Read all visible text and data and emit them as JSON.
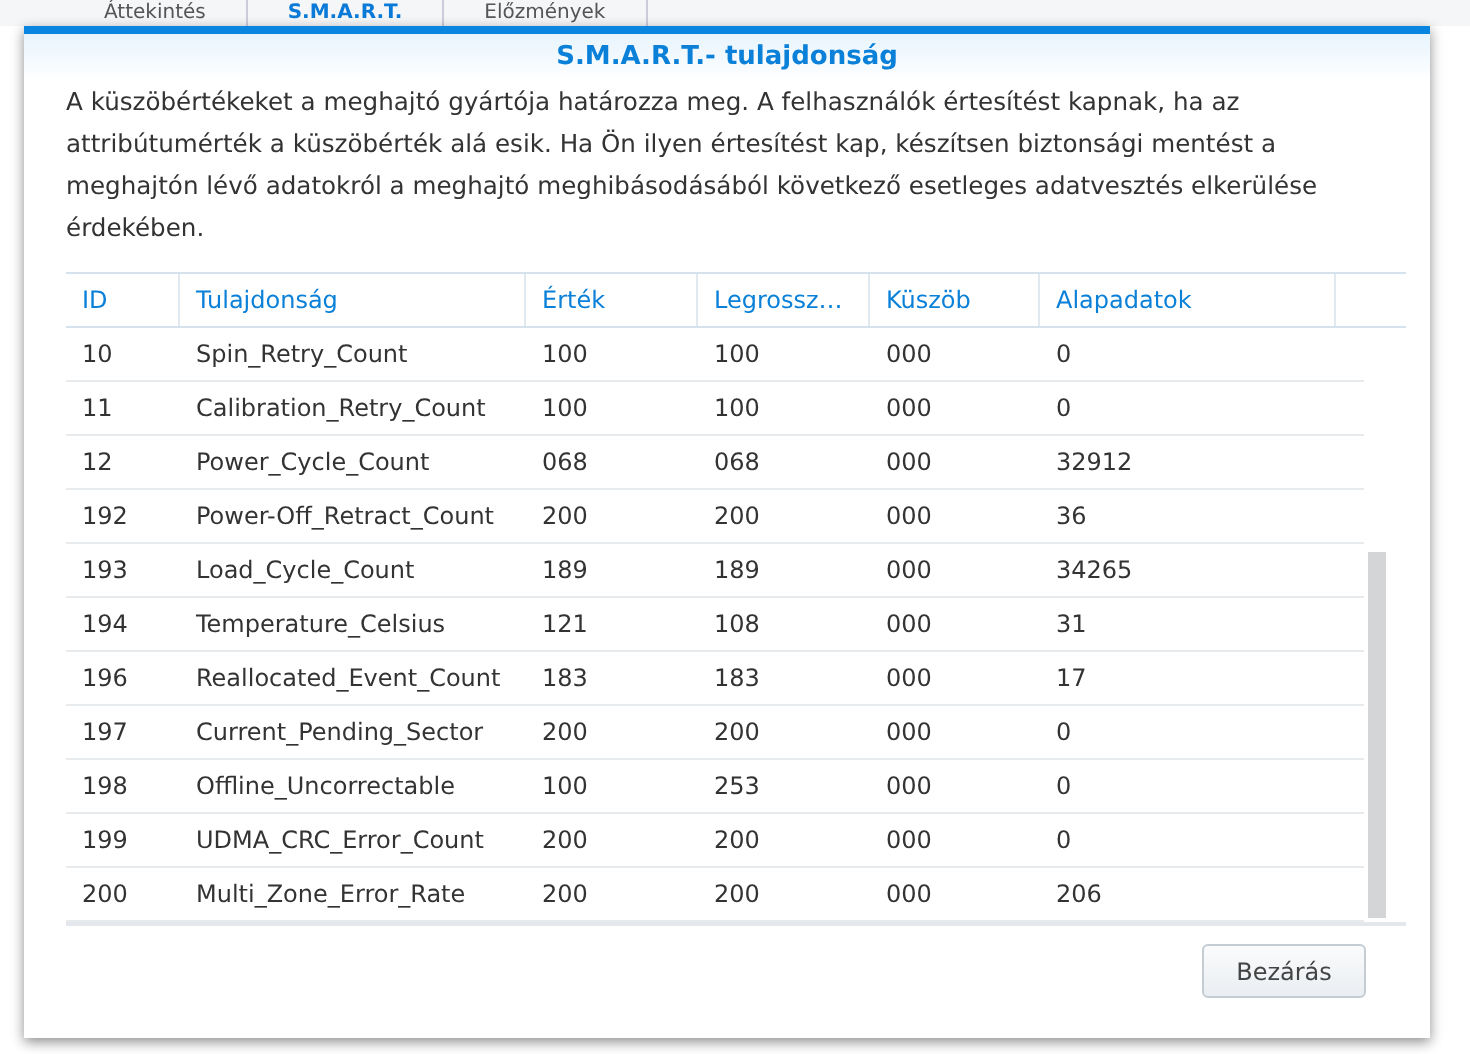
{
  "background_tabs": [
    {
      "label": "Áttekintés",
      "selected": false
    },
    {
      "label": "S.M.A.R.T.",
      "selected": true
    },
    {
      "label": "Előzmények",
      "selected": false
    }
  ],
  "dialog": {
    "title": "S.M.A.R.T.- tulajdonság",
    "description": "A küszöbértékeket a meghajtó gyártója határozza meg. A felhasználók értesítést kapnak, ha az attribútumérték a küszöbérték alá esik. Ha Ön ilyen értesítést kap, készítsen biztonsági mentést a meghajtón lévő adatokról a meghajtó meghibásodásából következő esetleges adatvesztés elkerülése érdekében."
  },
  "table": {
    "columns": [
      "ID",
      "Tulajdonság",
      "Érték",
      "Legrossz…",
      "Küszöb",
      "Alapadatok"
    ],
    "rows": [
      [
        "10",
        "Spin_Retry_Count",
        "100",
        "100",
        "000",
        "0"
      ],
      [
        "11",
        "Calibration_Retry_Count",
        "100",
        "100",
        "000",
        "0"
      ],
      [
        "12",
        "Power_Cycle_Count",
        "068",
        "068",
        "000",
        "32912"
      ],
      [
        "192",
        "Power-Off_Retract_Count",
        "200",
        "200",
        "000",
        "36"
      ],
      [
        "193",
        "Load_Cycle_Count",
        "189",
        "189",
        "000",
        "34265"
      ],
      [
        "194",
        "Temperature_Celsius",
        "121",
        "108",
        "000",
        "31"
      ],
      [
        "196",
        "Reallocated_Event_Count",
        "183",
        "183",
        "000",
        "17"
      ],
      [
        "197",
        "Current_Pending_Sector",
        "200",
        "200",
        "000",
        "0"
      ],
      [
        "198",
        "Offline_Uncorrectable",
        "100",
        "253",
        "000",
        "0"
      ],
      [
        "199",
        "UDMA_CRC_Error_Count",
        "200",
        "200",
        "000",
        "0"
      ],
      [
        "200",
        "Multi_Zone_Error_Rate",
        "200",
        "200",
        "000",
        "206"
      ]
    ]
  },
  "buttons": [
    "Bezárás"
  ]
}
